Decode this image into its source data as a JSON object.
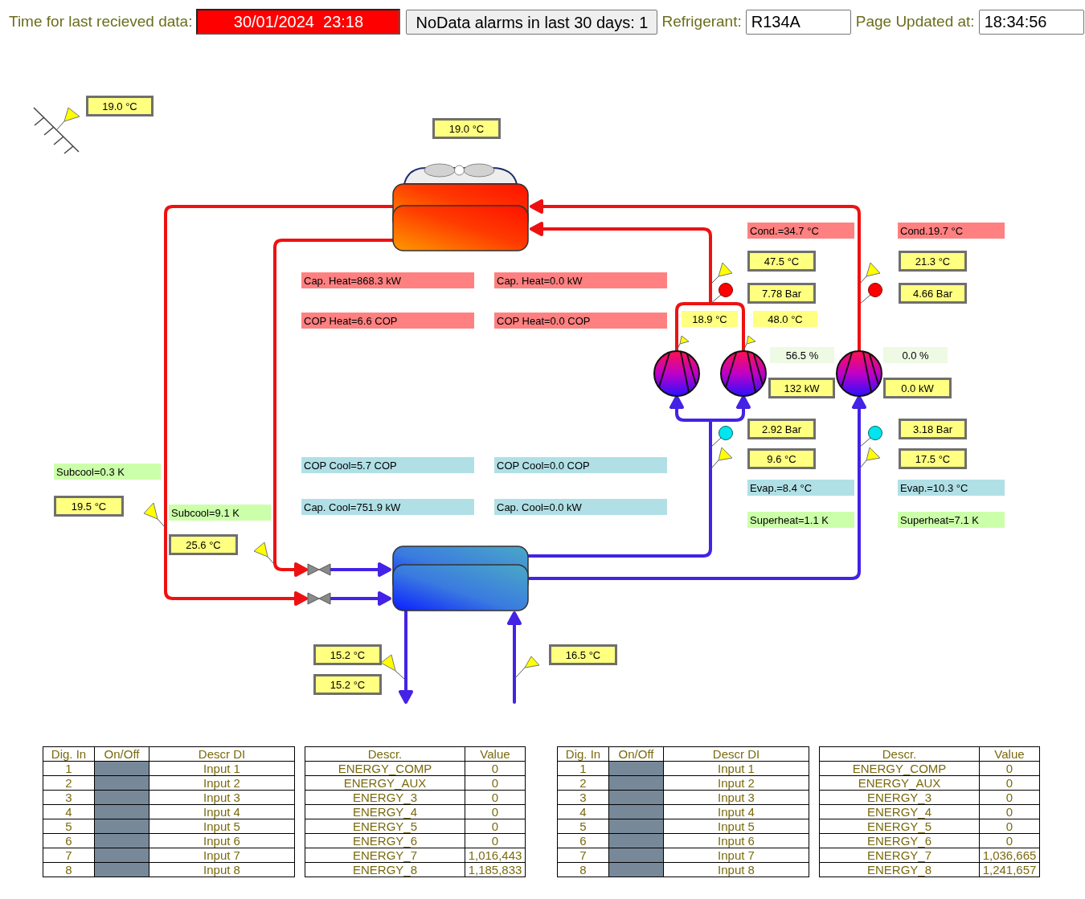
{
  "header": {
    "last_data": {
      "label": "Time for last recieved data:",
      "value": "30/01/2024  23:18",
      "alarm": true
    },
    "alarm_button": "NoData alarms in last 30 days: 1",
    "refrigerant": {
      "label": "Refrigerant:",
      "value": "R134A"
    },
    "updated": {
      "label": "Page Updated at:",
      "value": "18:34:56"
    }
  },
  "diagram": {
    "labels": [
      {
        "kind": "gauge",
        "text": "19.0 °C"
      },
      {
        "kind": "gauge",
        "text": "19.0 °C"
      },
      {
        "kind": "heat",
        "text": "Cond.=34.7 °C"
      },
      {
        "kind": "heat",
        "text": "Cond.19.7 °C"
      },
      {
        "kind": "gauge",
        "text": "47.5 °C"
      },
      {
        "kind": "gauge",
        "text": "21.3 °C"
      },
      {
        "kind": "heat",
        "text": "Cap. Heat=868.3 kW"
      },
      {
        "kind": "heat",
        "text": "Cap. Heat=0.0 kW"
      },
      {
        "kind": "gauge",
        "text": "7.78 Bar"
      },
      {
        "kind": "gauge",
        "text": "4.66 Bar"
      },
      {
        "kind": "heat",
        "text": "COP Heat=6.6 COP"
      },
      {
        "kind": "heat",
        "text": "COP Heat=0.0 COP"
      },
      {
        "kind": "value",
        "text": "18.9 °C"
      },
      {
        "kind": "value",
        "text": "48.0 °C"
      },
      {
        "kind": "load",
        "text": "56.5 %"
      },
      {
        "kind": "load",
        "text": "0.0 %"
      },
      {
        "kind": "gauge",
        "text": "132 kW"
      },
      {
        "kind": "gauge",
        "text": "0.0 kW"
      },
      {
        "kind": "gauge",
        "text": "2.92 Bar"
      },
      {
        "kind": "gauge",
        "text": "3.18 Bar"
      },
      {
        "kind": "delta",
        "text": "Subcool=0.3 K"
      },
      {
        "kind": "cool",
        "text": "COP Cool=5.7 COP"
      },
      {
        "kind": "cool",
        "text": "COP Cool=0.0 COP"
      },
      {
        "kind": "gauge",
        "text": "9.6 °C"
      },
      {
        "kind": "gauge",
        "text": "17.5 °C"
      },
      {
        "kind": "cool",
        "text": "Evap.=8.4 °C"
      },
      {
        "kind": "cool",
        "text": "Evap.=10.3 °C"
      },
      {
        "kind": "gauge",
        "text": "19.5 °C"
      },
      {
        "kind": "delta",
        "text": "Subcool=9.1 K"
      },
      {
        "kind": "cool",
        "text": "Cap. Cool=751.9 kW"
      },
      {
        "kind": "cool",
        "text": "Cap. Cool=0.0 kW"
      },
      {
        "kind": "delta",
        "text": "Superheat=1.1 K"
      },
      {
        "kind": "delta",
        "text": "Superheat=7.1 K"
      },
      {
        "kind": "gauge",
        "text": "25.6 °C"
      },
      {
        "kind": "gauge",
        "text": "15.2 °C"
      },
      {
        "kind": "gauge",
        "text": "16.5 °C"
      },
      {
        "kind": "gauge",
        "text": "15.2 °C"
      }
    ]
  },
  "tables": [
    {
      "inputs": {
        "columns": [
          "Dig. In",
          "On/Off",
          "Descr DI"
        ],
        "rows": [
          {
            "number": "1",
            "on": false,
            "description": "Input 1"
          },
          {
            "number": "2",
            "on": false,
            "description": "Input 2"
          },
          {
            "number": "3",
            "on": false,
            "description": "Input 3"
          },
          {
            "number": "4",
            "on": false,
            "description": "Input 4"
          },
          {
            "number": "5",
            "on": false,
            "description": "Input 5"
          },
          {
            "number": "6",
            "on": false,
            "description": "Input 6"
          },
          {
            "number": "7",
            "on": false,
            "description": "Input 7"
          },
          {
            "number": "8",
            "on": false,
            "description": "Input 8"
          }
        ]
      },
      "energy": {
        "columns": [
          "Descr.",
          "Value"
        ],
        "rows": [
          {
            "description": "ENERGY_COMP",
            "value": "0"
          },
          {
            "description": "ENERGY_AUX",
            "value": "0"
          },
          {
            "description": "ENERGY_3",
            "value": "0"
          },
          {
            "description": "ENERGY_4",
            "value": "0"
          },
          {
            "description": "ENERGY_5",
            "value": "0"
          },
          {
            "description": "ENERGY_6",
            "value": "0"
          },
          {
            "description": "ENERGY_7",
            "value": "1,016,443"
          },
          {
            "description": "ENERGY_8",
            "value": "1,185,833"
          }
        ]
      }
    },
    {
      "inputs": {
        "columns": [
          "Dig. In",
          "On/Off",
          "Descr DI"
        ],
        "rows": [
          {
            "number": "1",
            "on": false,
            "description": "Input 1"
          },
          {
            "number": "2",
            "on": false,
            "description": "Input 2"
          },
          {
            "number": "3",
            "on": false,
            "description": "Input 3"
          },
          {
            "number": "4",
            "on": false,
            "description": "Input 4"
          },
          {
            "number": "5",
            "on": false,
            "description": "Input 5"
          },
          {
            "number": "6",
            "on": false,
            "description": "Input 6"
          },
          {
            "number": "7",
            "on": false,
            "description": "Input 7"
          },
          {
            "number": "8",
            "on": false,
            "description": "Input 8"
          }
        ]
      },
      "energy": {
        "columns": [
          "Descr.",
          "Value"
        ],
        "rows": [
          {
            "description": "ENERGY_COMP",
            "value": "0"
          },
          {
            "description": "ENERGY_AUX",
            "value": "0"
          },
          {
            "description": "ENERGY_3",
            "value": "0"
          },
          {
            "description": "ENERGY_4",
            "value": "0"
          },
          {
            "description": "ENERGY_5",
            "value": "0"
          },
          {
            "description": "ENERGY_6",
            "value": "0"
          },
          {
            "description": "ENERGY_7",
            "value": "1,036,665"
          },
          {
            "description": "ENERGY_8",
            "value": "1,241,657"
          }
        ]
      }
    }
  ]
}
